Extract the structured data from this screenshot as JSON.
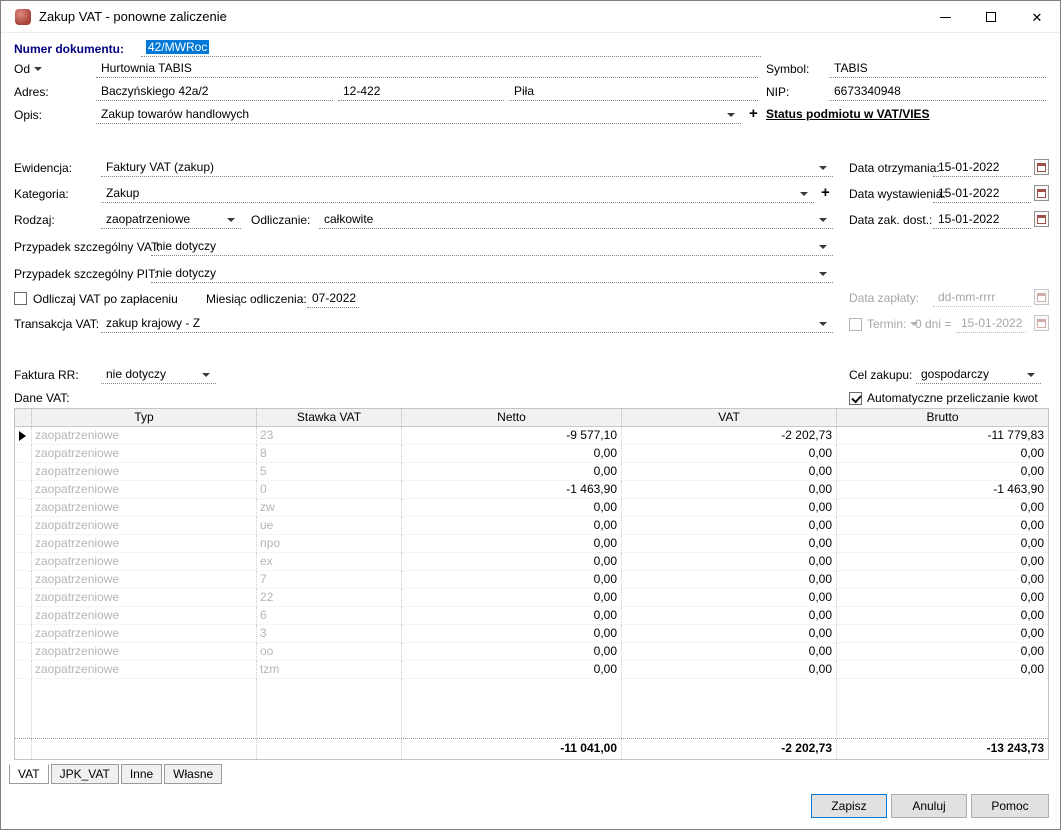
{
  "window": {
    "title": "Zakup VAT - ponowne zaliczenie",
    "controls": {
      "close_glyph": "✕"
    }
  },
  "accent": {
    "selection_bg": "#0078d7",
    "label_navy": "#00007f"
  },
  "doc": {
    "numer_label": "Numer dokumentu:",
    "numer_value": "42/MWRoc",
    "od_label": "Od",
    "od_value": "Hurtownia TABIS",
    "symbol_label": "Symbol:",
    "symbol_value": "TABIS",
    "adres_label": "Adres:",
    "adres_ulica": "Baczyńskiego  42a/2",
    "adres_kod": "12-422",
    "adres_miasto": "Piła",
    "nip_label": "NIP:",
    "nip_value": "6673340948",
    "opis_label": "Opis:",
    "opis_value": "Zakup towarów handlowych",
    "opis_add": "+",
    "vies_link": "Status podmiotu w VAT/VIES"
  },
  "evidence": {
    "ewidencja_label": "Ewidencja:",
    "ewidencja_value": "Faktury VAT (zakup)",
    "kategoria_label": "Kategoria:",
    "kategoria_value": "Zakup",
    "kategoria_add": "+",
    "rodzaj_label": "Rodzaj:",
    "rodzaj_value": "zaopatrzeniowe",
    "odliczanie_label": "Odliczanie:",
    "odliczanie_value": "całkowite",
    "przypadek_vat_label": "Przypadek szczególny VAT:",
    "przypadek_vat_value": "nie dotyczy",
    "przypadek_pit_label": "Przypadek szczególny PIT:",
    "przypadek_pit_value": "nie dotyczy",
    "odliczaj_label": "Odliczaj VAT po zapłaceniu",
    "miesiac_label": "Miesiąc odliczenia:",
    "miesiac_value": "07-2022",
    "transakcja_label": "Transakcja VAT:",
    "transakcja_value": "zakup krajowy - Z"
  },
  "dates": {
    "otrzymania_label": "Data otrzymania:",
    "otrzymania_value": "15-01-2022",
    "wystawienia_label": "Data wystawienia:",
    "wystawienia_value": "15-01-2022",
    "zak_dost_label": "Data zak. dost.:",
    "zak_dost_value": "15-01-2022",
    "zaplaty_label": "Data zapłaty:",
    "zaplaty_value": "dd-mm-rrrr",
    "termin_label": "Termin:",
    "termin_dni": "0 dni =",
    "termin_date": "15-01-2022"
  },
  "purchase": {
    "faktura_rr_label": "Faktura RR:",
    "faktura_rr_value": "nie dotyczy",
    "cel_label": "Cel zakupu:",
    "cel_value": "gospodarczy",
    "dane_vat_label": "Dane VAT:",
    "auto_label": "Automatyczne przeliczanie kwot"
  },
  "grid": {
    "columns": [
      "Typ",
      "Stawka VAT",
      "Netto",
      "VAT",
      "Brutto"
    ],
    "rows": [
      {
        "typ": "zaopatrzeniowe",
        "stawka": "23",
        "netto": "-9 577,10",
        "vat": "-2 202,73",
        "brutto": "-11 779,83"
      },
      {
        "typ": "zaopatrzeniowe",
        "stawka": "8",
        "netto": "0,00",
        "vat": "0,00",
        "brutto": "0,00"
      },
      {
        "typ": "zaopatrzeniowe",
        "stawka": "5",
        "netto": "0,00",
        "vat": "0,00",
        "brutto": "0,00"
      },
      {
        "typ": "zaopatrzeniowe",
        "stawka": "0",
        "netto": "-1 463,90",
        "vat": "0,00",
        "brutto": "-1 463,90"
      },
      {
        "typ": "zaopatrzeniowe",
        "stawka": "zw",
        "netto": "0,00",
        "vat": "0,00",
        "brutto": "0,00"
      },
      {
        "typ": "zaopatrzeniowe",
        "stawka": "ue",
        "netto": "0,00",
        "vat": "0,00",
        "brutto": "0,00"
      },
      {
        "typ": "zaopatrzeniowe",
        "stawka": "npo",
        "netto": "0,00",
        "vat": "0,00",
        "brutto": "0,00"
      },
      {
        "typ": "zaopatrzeniowe",
        "stawka": "ex",
        "netto": "0,00",
        "vat": "0,00",
        "brutto": "0,00"
      },
      {
        "typ": "zaopatrzeniowe",
        "stawka": "7",
        "netto": "0,00",
        "vat": "0,00",
        "brutto": "0,00"
      },
      {
        "typ": "zaopatrzeniowe",
        "stawka": "22",
        "netto": "0,00",
        "vat": "0,00",
        "brutto": "0,00"
      },
      {
        "typ": "zaopatrzeniowe",
        "stawka": "6",
        "netto": "0,00",
        "vat": "0,00",
        "brutto": "0,00"
      },
      {
        "typ": "zaopatrzeniowe",
        "stawka": "3",
        "netto": "0,00",
        "vat": "0,00",
        "brutto": "0,00"
      },
      {
        "typ": "zaopatrzeniowe",
        "stawka": "oo",
        "netto": "0,00",
        "vat": "0,00",
        "brutto": "0,00"
      },
      {
        "typ": "zaopatrzeniowe",
        "stawka": "tzm",
        "netto": "0,00",
        "vat": "0,00",
        "brutto": "0,00"
      }
    ],
    "summary": {
      "netto": "-11 041,00",
      "vat": "-2 202,73",
      "brutto": "-13 243,73"
    }
  },
  "tabs": [
    {
      "label": "VAT"
    },
    {
      "label": "JPK_VAT"
    },
    {
      "label": "Inne"
    },
    {
      "label": "Własne"
    }
  ],
  "buttons": {
    "zapisz": "Zapisz",
    "anuluj": "Anuluj",
    "pomoc": "Pomoc"
  }
}
